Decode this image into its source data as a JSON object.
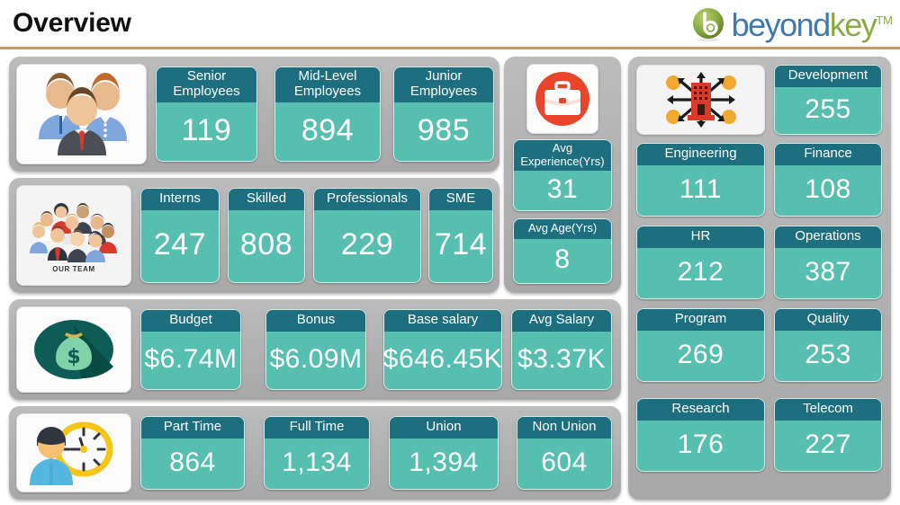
{
  "header": {
    "title": "Overview",
    "logo": {
      "part1": "beyond",
      "part2": "key",
      "tm": "TM",
      "mark_icon": "beyondkey-b-circle-icon",
      "color_part1": "#3c78b4",
      "color_part2": "#8aab43"
    },
    "accent_rule_color": "#cc9966"
  },
  "theme": {
    "card_header_color": "#1d6e7e",
    "card_body_color": "#56bfb0",
    "panel_color": "#b2b2b2",
    "text_color": "#ffffff"
  },
  "panels": {
    "experience_level": {
      "icon": "three-people-group-icon",
      "cards": [
        {
          "label": "Senior Employees",
          "value": "119"
        },
        {
          "label": "Mid-Level Employees",
          "value": "894"
        },
        {
          "label": "Junior Employees",
          "value": "985"
        }
      ]
    },
    "skill_level": {
      "icon": "our-team-crowd-icon",
      "icon_caption": "OUR TEAM",
      "cards": [
        {
          "label": "Interns",
          "value": "247"
        },
        {
          "label": "Skilled",
          "value": "808"
        },
        {
          "label": "Professionals",
          "value": "229"
        },
        {
          "label": "SME",
          "value": "714"
        }
      ]
    },
    "compensation": {
      "icon": "money-bag-icon",
      "cards": [
        {
          "label": "Budget",
          "value": "$6.74M"
        },
        {
          "label": "Bonus",
          "value": "$6.09M"
        },
        {
          "label": "Base salary",
          "value": "$646.45K"
        },
        {
          "label": "Avg Salary",
          "value": "$3.37K"
        }
      ]
    },
    "employment_type": {
      "icon": "person-clock-icon",
      "cards": [
        {
          "label": "Part Time",
          "value": "864"
        },
        {
          "label": "Full Time",
          "value": "1,134"
        },
        {
          "label": "Union",
          "value": "1,394"
        },
        {
          "label": "Non Union",
          "value": "604"
        }
      ]
    },
    "averages": {
      "icon": "briefcase-circle-icon",
      "cards": [
        {
          "label": "Avg Experience(Yrs)",
          "value": "31"
        },
        {
          "label": "Avg Age(Yrs)",
          "value": "8"
        }
      ]
    },
    "departments": {
      "icon": "building-network-icon",
      "cards": [
        {
          "label": "Development",
          "value": "255"
        },
        {
          "label": "Engineering",
          "value": "111"
        },
        {
          "label": "Finance",
          "value": "108"
        },
        {
          "label": "HR",
          "value": "212"
        },
        {
          "label": "Operations",
          "value": "387"
        },
        {
          "label": "Program",
          "value": "269"
        },
        {
          "label": "Quality",
          "value": "253"
        },
        {
          "label": "Research",
          "value": "176"
        },
        {
          "label": "Telecom",
          "value": "227"
        }
      ]
    }
  }
}
